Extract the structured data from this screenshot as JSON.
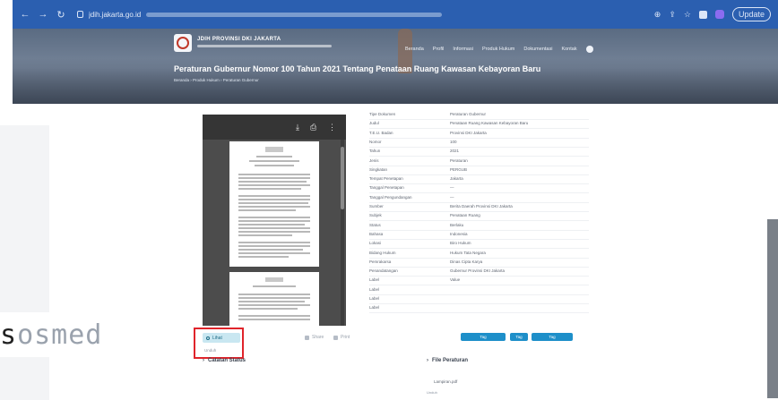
{
  "browser": {
    "url": "jdih.jakarta.go.id",
    "update_label": "Update"
  },
  "header": {
    "site_title": "JDIH PROVINSI DKI JAKARTA",
    "page_title": "Peraturan Gubernur Nomor 100 Tahun 2021 Tentang Penataan Ruang Kawasan Kebayoran Baru",
    "breadcrumb": "Beranda › Produk Hukum › Peraturan Gubernur",
    "menu": [
      "Beranda",
      "Profil",
      "Informasi",
      "Produk Hukum",
      "Dokumentasi",
      "Kontak"
    ]
  },
  "pdf_viewer": {
    "view_label": "Lihat",
    "small_link": "Unduh",
    "foot_left": "Share",
    "foot_right": "Print"
  },
  "metadata": [
    {
      "label": "Tipe Dokumen",
      "value": "Peraturan Gubernur"
    },
    {
      "label": "Judul",
      "value": "Penataan Ruang Kawasan Kebayoran Baru"
    },
    {
      "label": "T.E.U. Badan",
      "value": "Provinsi DKI Jakarta"
    },
    {
      "label": "Nomor",
      "value": "100"
    },
    {
      "label": "Tahun",
      "value": "2021"
    },
    {
      "label": "Jenis",
      "value": "Peraturan"
    },
    {
      "label": "Singkatan",
      "value": "PERGUB"
    },
    {
      "label": "Tempat Penetapan",
      "value": "Jakarta"
    },
    {
      "label": "Tanggal Penetapan",
      "value": "—"
    },
    {
      "label": "Tanggal Pengundangan",
      "value": "—"
    },
    {
      "label": "Sumber",
      "value": "Berita Daerah Provinsi DKI Jakarta"
    },
    {
      "label": "Subjek",
      "value": "Penataan Ruang"
    },
    {
      "label": "Status",
      "value": "Berlaku"
    },
    {
      "label": "Bahasa",
      "value": "Indonesia"
    },
    {
      "label": "Lokasi",
      "value": "Biro Hukum"
    },
    {
      "label": "Bidang Hukum",
      "value": "Hukum Tata Negara"
    },
    {
      "label": "Pemrakarsa",
      "value": "Dinas Cipta Karya"
    },
    {
      "label": "Penandatangan",
      "value": "Gubernur Provinsi DKI Jakarta"
    },
    {
      "label": "Label",
      "value": "Value"
    },
    {
      "label": "Label",
      "value": ""
    },
    {
      "label": "Label",
      "value": ""
    },
    {
      "label": "Label",
      "value": ""
    }
  ],
  "tags": [
    "Tag",
    "Tag",
    "Tag"
  ],
  "sections": {
    "left_title": "Catatan Status",
    "right_title": "File Peraturan",
    "attachment": "Lampiran.pdf",
    "attachment_sub": "Unduh"
  },
  "watermark": {
    "first": "s",
    "rest": "osmed"
  }
}
